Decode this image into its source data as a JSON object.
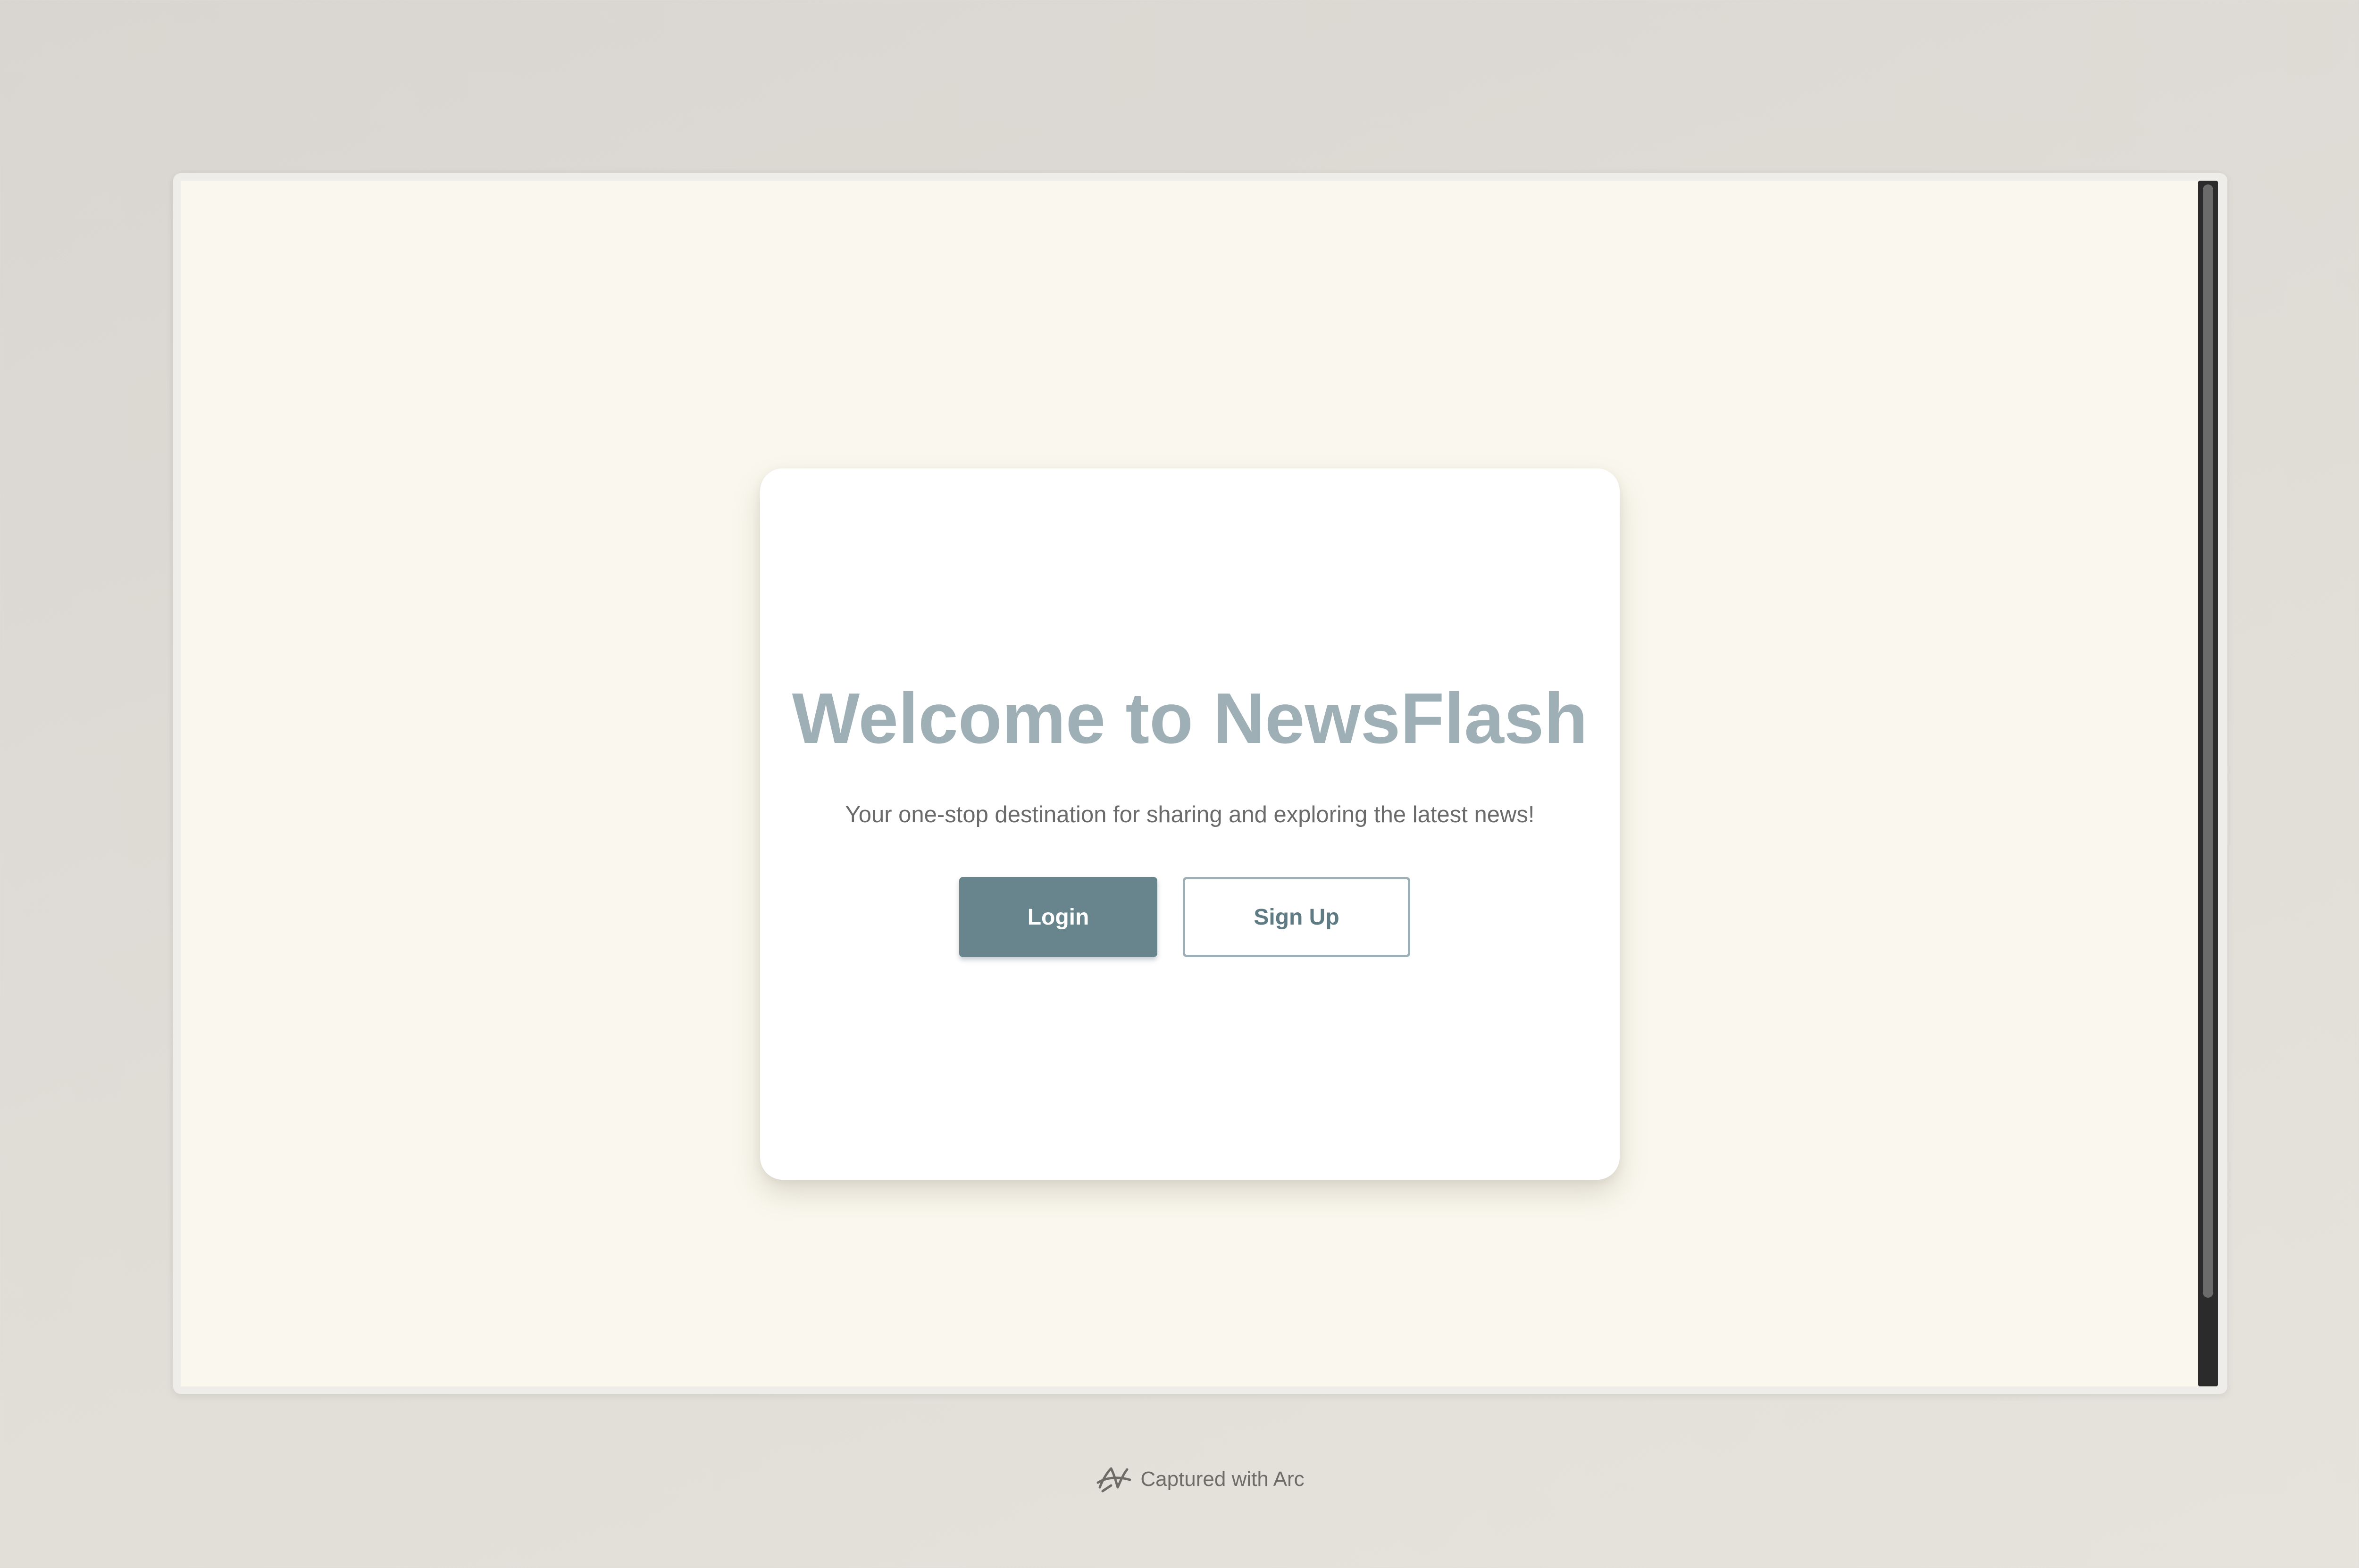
{
  "page": {
    "title": "Welcome to NewsFlash",
    "subtitle": "Your one-stop destination for sharing and exploring the latest news!"
  },
  "buttons": {
    "login_label": "Login",
    "signup_label": "Sign Up"
  },
  "footer": {
    "capture_text": "Captured with Arc",
    "icon": "arc-logo-icon"
  },
  "colors": {
    "page_background": "#faf8ee",
    "title": "#9eb0b6",
    "login_button": "#68858d",
    "signup_border": "#9eb0b6",
    "signup_text": "#5f7c85"
  }
}
